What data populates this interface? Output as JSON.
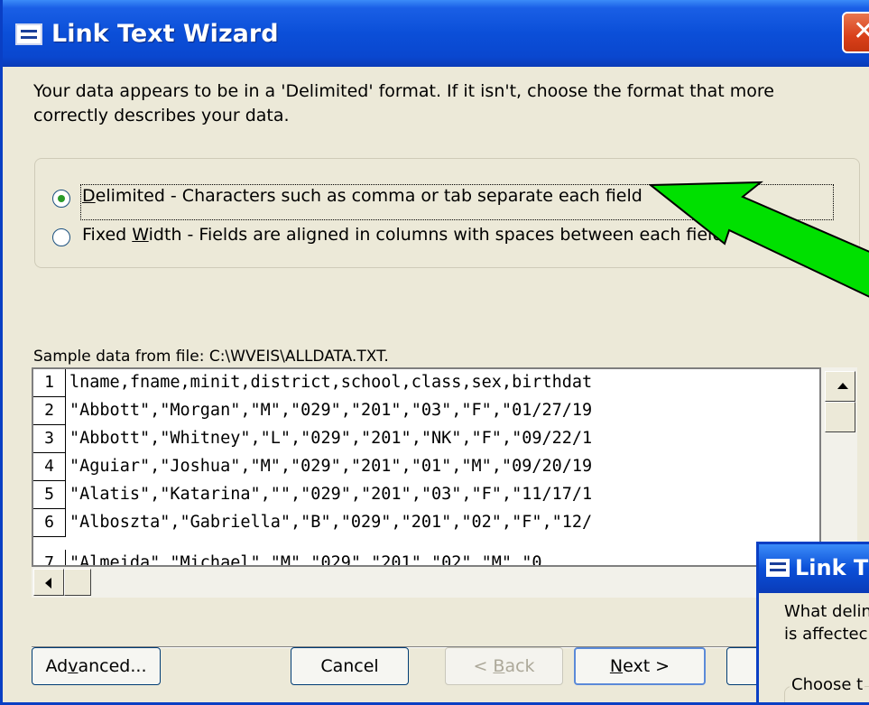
{
  "window": {
    "title": "Link Text Wizard",
    "close_glyph": "✕"
  },
  "intro_text": "Your data appears to be in a 'Delimited' format. If it isn't, choose the format that more correctly describes your data.",
  "format_options": [
    {
      "prefix": "",
      "accel": "D",
      "rest": "elimited - Characters such as comma or tab separate each field",
      "checked": true
    },
    {
      "prefix": "Fixed ",
      "accel": "W",
      "rest": "idth - Fields are aligned in columns with spaces between each field",
      "checked": false
    }
  ],
  "sample": {
    "label": "Sample data from file: C:\\WVEIS\\ALLDATA.TXT.",
    "rows": [
      {
        "num": "1",
        "text": "lname,fname,minit,district,school,class,sex,birthdat"
      },
      {
        "num": "2",
        "text": "\"Abbott\",\"Morgan\",\"M\",\"029\",\"201\",\"03\",\"F\",\"01/27/19"
      },
      {
        "num": "3",
        "text": "\"Abbott\",\"Whitney\",\"L\",\"029\",\"201\",\"NK\",\"F\",\"09/22/1"
      },
      {
        "num": "4",
        "text": "\"Aguiar\",\"Joshua\",\"M\",\"029\",\"201\",\"01\",\"M\",\"09/20/19"
      },
      {
        "num": "5",
        "text": "\"Alatis\",\"Katarina\",\"\",\"029\",\"201\",\"03\",\"F\",\"11/17/1"
      },
      {
        "num": "6",
        "text": "\"Alboszta\",\"Gabriella\",\"B\",\"029\",\"201\",\"02\",\"F\",\"12/"
      },
      {
        "num": "7",
        "text": "\"Almeida\",\"Michael\",\"M\",\"029\",\"201\",\"02\",\"M\",\"0"
      }
    ]
  },
  "buttons": {
    "advanced": {
      "pre": "Ad",
      "accel": "v",
      "post": "anced..."
    },
    "cancel": {
      "label": "Cancel"
    },
    "back": {
      "pre": "< ",
      "accel": "B",
      "post": "ack"
    },
    "next": {
      "pre": "",
      "accel": "N",
      "post": "ext >"
    }
  },
  "overlay_dialog": {
    "title": "Link T",
    "body": "What delin\nis affectec",
    "group_label": "Choose t"
  },
  "annotation": {
    "arrow_color": "#00e000"
  }
}
